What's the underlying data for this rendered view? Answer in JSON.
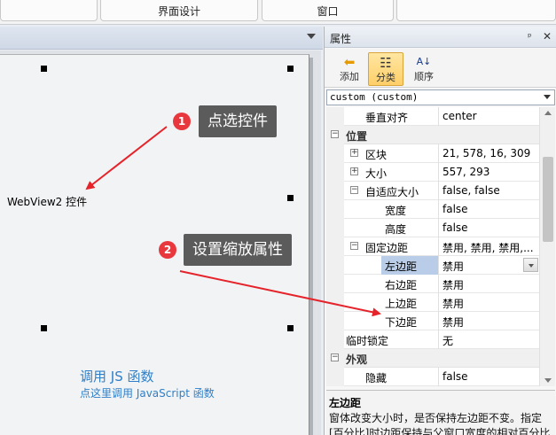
{
  "ribbon": {
    "buttons": [
      {
        "label": "",
        "sub": ""
      },
      {
        "label": "界面设计",
        "sub": "(   )"
      },
      {
        "label": "窗口",
        "sub": ""
      },
      {
        "label": "",
        "sub": ""
      }
    ]
  },
  "designer": {
    "control_label": "WebView2 控件",
    "js_title": "调用 JS 函数",
    "js_link": "点这里调用 JavaScript 函数",
    "callouts": [
      {
        "num": "1",
        "text": "点选控件"
      },
      {
        "num": "2",
        "text": "设置缩放属性"
      }
    ]
  },
  "properties": {
    "title": "属性",
    "pin_glyph": "ᵖ",
    "close_glyph": "✕",
    "tools": [
      {
        "label": "添加",
        "icon": "arrow-left-icon",
        "glyph": "⬅"
      },
      {
        "label": "分类",
        "icon": "categorized-icon",
        "glyph": "☷"
      },
      {
        "label": "顺序",
        "icon": "sort-az-icon",
        "glyph": "A↓"
      }
    ],
    "object_selector": "custom (custom)",
    "rows": [
      {
        "name": "垂直对齐",
        "value": "center",
        "indent": 1,
        "toggle": ""
      },
      {
        "name": "位置",
        "value": "",
        "indent": 0,
        "toggle": "−",
        "category": true
      },
      {
        "name": "区块",
        "value": "21, 578, 16, 309",
        "indent": 1,
        "toggle": "+"
      },
      {
        "name": "大小",
        "value": "557, 293",
        "indent": 1,
        "toggle": "+"
      },
      {
        "name": "自适应大小",
        "value": "false, false",
        "indent": 1,
        "toggle": "−"
      },
      {
        "name": "宽度",
        "value": "false",
        "indent": 2,
        "toggle": ""
      },
      {
        "name": "高度",
        "value": "false",
        "indent": 2,
        "toggle": ""
      },
      {
        "name": "固定边距",
        "value": "禁用, 禁用, 禁用,...",
        "indent": 1,
        "toggle": "−"
      },
      {
        "name": "左边距",
        "value": "禁用",
        "indent": 2,
        "toggle": "",
        "selected": true
      },
      {
        "name": "右边距",
        "value": "禁用",
        "indent": 2,
        "toggle": ""
      },
      {
        "name": "上边距",
        "value": "禁用",
        "indent": 2,
        "toggle": ""
      },
      {
        "name": "下边距",
        "value": "禁用",
        "indent": 2,
        "toggle": ""
      },
      {
        "name": "临时锁定",
        "value": "无",
        "indent": 0,
        "toggle": ""
      },
      {
        "name": "外观",
        "value": "",
        "indent": 0,
        "toggle": "−",
        "category": true
      },
      {
        "name": "隐藏",
        "value": "false",
        "indent": 1,
        "toggle": ""
      }
    ],
    "description": {
      "title": "左边距",
      "text": "窗体改变大小时，是否保持左边距不变。指定[百分比]时边距保持与父窗口宽度的相对百分比"
    }
  },
  "colors": {
    "accent": "#2f7fc8",
    "badge": "#e8383d",
    "arrow": "#e5232b",
    "selected_row": "#b9cde8"
  }
}
